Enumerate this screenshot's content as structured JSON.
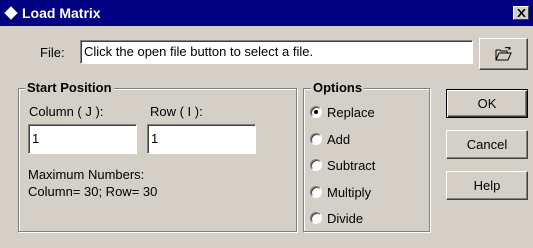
{
  "window": {
    "title": "Load Matrix"
  },
  "file": {
    "label": "File:",
    "value": "Click the open file button to select a file."
  },
  "start_position": {
    "legend": "Start Position",
    "column_label": "Column ( J ):",
    "column_value": "1",
    "row_label": "Row ( I ):",
    "row_value": "1",
    "max_label": "Maximum Numbers:",
    "max_values": "Column= 30; Row= 30"
  },
  "options": {
    "legend": "Options",
    "items": [
      {
        "label": "Replace",
        "checked": true
      },
      {
        "label": "Add",
        "checked": false
      },
      {
        "label": "Subtract",
        "checked": false
      },
      {
        "label": "Multiply",
        "checked": false
      },
      {
        "label": "Divide",
        "checked": false
      }
    ]
  },
  "buttons": {
    "ok": "OK",
    "cancel": "Cancel",
    "help": "Help"
  },
  "icons": {
    "title": "diamond-app-icon",
    "close": "close-icon",
    "open_file": "open-folder-icon"
  }
}
